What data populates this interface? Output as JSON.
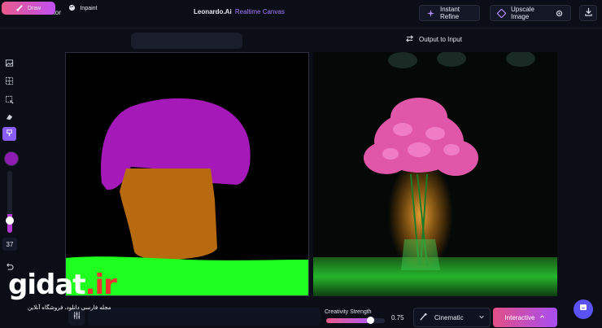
{
  "header": {
    "exit_label": "Exit the editor",
    "title_brand": "Leonardo.Ai",
    "title_accent": "Realtime Canvas",
    "instant_refine_label": "Instant Refine",
    "upscale_label": "Upscale Image",
    "settings_icon": "gear-icon",
    "download_icon": "download-icon"
  },
  "modes": [
    {
      "label": "Draw",
      "active": true,
      "icon": "brush-icon"
    },
    {
      "label": "Inpaint",
      "active": false,
      "icon": "palette-icon"
    }
  ],
  "output_to_input_label": "Output to Input",
  "toolbar": {
    "tools": [
      "image-icon",
      "grid-select-icon",
      "crop-icon",
      "eraser-icon",
      "brush-tool-icon"
    ],
    "active_tool": "brush-tool-icon",
    "brush_color": "#8e1cb3",
    "brush_size": "37",
    "opacity_level": 0.3
  },
  "bottom": {
    "creativity_label": "Creativity Strength",
    "creativity_value": "0.75",
    "style_label": "Cinematic",
    "interactive_label": "Interactive"
  },
  "watermark": {
    "logo_main": "gidat",
    "logo_suffix": ".ir",
    "tagline": "مجله فارسی دانلود، فروشگاه آنلاین"
  },
  "colors": {
    "accent": "#a77bff",
    "gradient_start": "#e85a8a",
    "gradient_end": "#b35af0",
    "chat": "#5b53f5"
  }
}
